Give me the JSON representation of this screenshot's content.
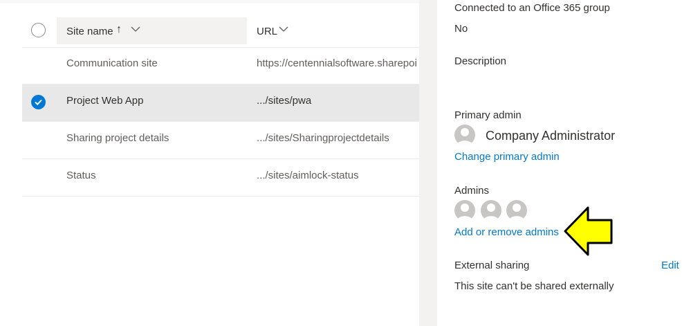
{
  "list": {
    "columns": {
      "site_name": "Site name",
      "sort_glyph": "↑",
      "url": "URL"
    },
    "rows": [
      {
        "name": "Communication site",
        "url": "https://centennialsoftware.sharepoi",
        "selected": false
      },
      {
        "name": "Project Web App",
        "url": ".../sites/pwa",
        "selected": true
      },
      {
        "name": "Sharing project details",
        "url": ".../sites/Sharingprojectdetails",
        "selected": false
      },
      {
        "name": "Status",
        "url": ".../sites/aimlock-status",
        "selected": false
      }
    ]
  },
  "panel": {
    "group_label": "Connected to an Office 365 group",
    "group_value": "No",
    "description_label": "Description",
    "primary_admin_label": "Primary admin",
    "primary_admin_name": "Company Administrator",
    "change_primary_link": "Change primary admin",
    "admins_label": "Admins",
    "admins_count": 3,
    "add_remove_link": "Add or remove admins",
    "external_sharing_label": "External sharing",
    "edit_link": "Edit",
    "external_sharing_value": "This site can't be shared externally"
  },
  "icons": {
    "checkmark": "checkmark-icon",
    "chevron": "chevron-down-icon",
    "person": "person-icon",
    "pointer": "arrow-left-icon"
  },
  "colors": {
    "accent": "#0078d4",
    "selected_row": "#e8e8e8",
    "pointer_arrow": "#ffff00"
  }
}
